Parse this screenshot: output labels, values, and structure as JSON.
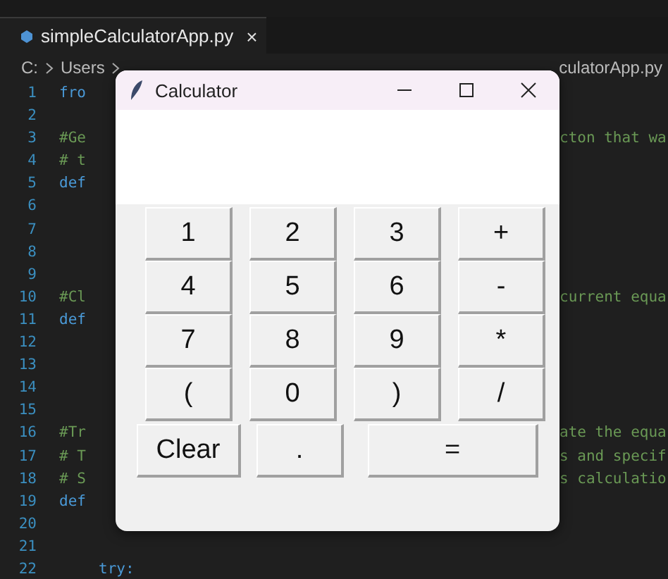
{
  "editor_tab": {
    "label": "simpleCalculatorApp.py",
    "close": "×"
  },
  "breadcrumb": {
    "left": [
      "C:",
      "Users"
    ],
    "right": "culatorApp.py"
  },
  "code_lines": [
    {
      "number": "1",
      "kind": "keyword",
      "left": "fro"
    },
    {
      "number": "2"
    },
    {
      "number": "3",
      "kind": "comment",
      "left": "#Ge",
      "right": "cton that wa"
    },
    {
      "number": "4",
      "kind": "comment",
      "left": "# t"
    },
    {
      "number": "5",
      "kind": "keyword",
      "left": "def"
    },
    {
      "number": "6"
    },
    {
      "number": "7"
    },
    {
      "number": "8"
    },
    {
      "number": "9"
    },
    {
      "number": "10",
      "kind": "comment",
      "left": "#Cl",
      "right": "current equa"
    },
    {
      "number": "11",
      "kind": "keyword",
      "left": "def"
    },
    {
      "number": "12"
    },
    {
      "number": "13"
    },
    {
      "number": "14"
    },
    {
      "number": "15"
    },
    {
      "number": "16",
      "kind": "comment",
      "left": "#Tr",
      "right": "ate the equa"
    },
    {
      "number": "17",
      "kind": "comment",
      "left": "# T",
      "right": "s and specif"
    },
    {
      "number": "18",
      "kind": "comment",
      "left": "# S",
      "right": "s calculatio"
    },
    {
      "number": "19",
      "kind": "keyword",
      "left": "def"
    },
    {
      "number": "20"
    },
    {
      "number": "21"
    },
    {
      "number": "22",
      "kind": "keyword",
      "indent": true,
      "left": "try:"
    }
  ],
  "window": {
    "title": "Calculator",
    "button_rows": [
      [
        "1",
        "2",
        "3",
        "+"
      ],
      [
        "4",
        "5",
        "6",
        "-"
      ],
      [
        "7",
        "8",
        "9",
        "*"
      ],
      [
        "(",
        "0",
        ")",
        "/"
      ]
    ],
    "bottom_row": [
      {
        "label": "Clear",
        "kind": "clear"
      },
      {
        "label": ".",
        "kind": "dot"
      },
      {
        "label": "=",
        "kind": "equals"
      }
    ]
  }
}
